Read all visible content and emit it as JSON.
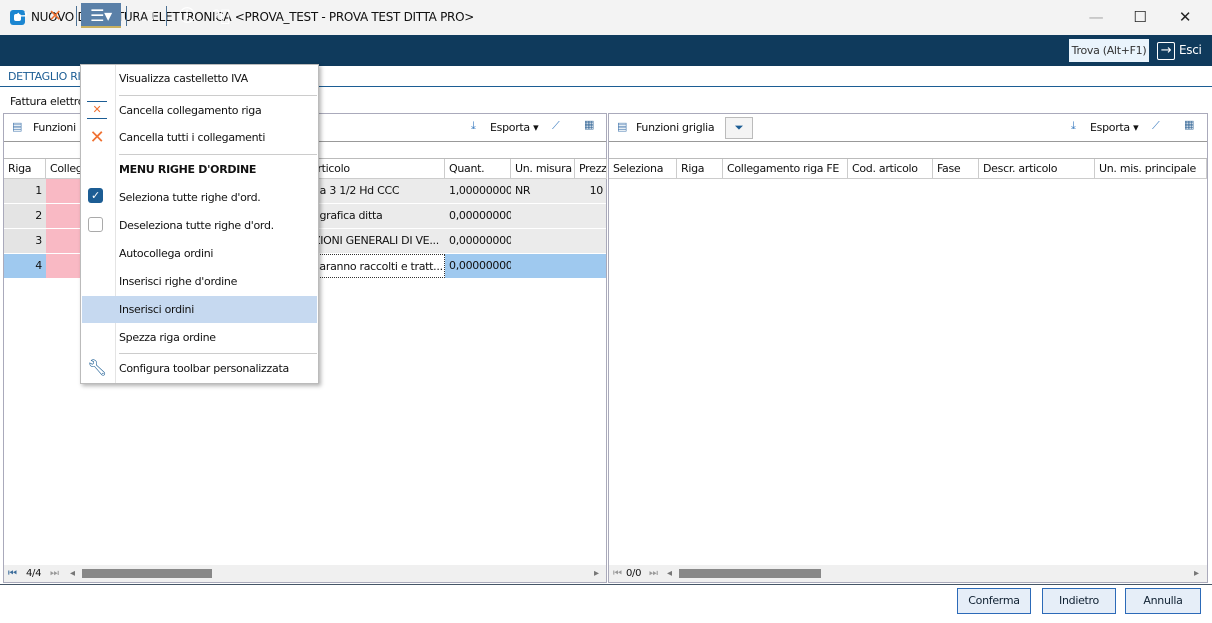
{
  "window": {
    "title": "NUOVO DA FATTURA ELETTRONICA <PROVA_TEST - PROVA TEST DITTA PRO>",
    "minimize": "—",
    "maximize": "☐",
    "close": "✕"
  },
  "toolbar": {
    "find": "Trova (Alt+F1)",
    "exit": "Esci"
  },
  "tab": {
    "label": "DETTAGLIO RI"
  },
  "section": {
    "label": "Fattura elettro"
  },
  "left": {
    "functions": "Funzioni",
    "export": "Esporta",
    "columns": [
      "Riga",
      "Colleg",
      "",
      "articolo",
      "Quant.",
      "Un. misura",
      "Prezz"
    ],
    "rows": [
      {
        "riga": "1",
        "articolo": "da 3 1/2 Hd CCC",
        "quant": "1,00000000",
        "um": "NR",
        "prezzo": "10"
      },
      {
        "riga": "2",
        "articolo": "agrafica ditta",
        "quant": "0,00000000",
        "um": "",
        "prezzo": ""
      },
      {
        "riga": "3",
        "articolo": "ZIONI GENERALI DI VE...",
        "quant": "0,00000000",
        "um": "",
        "prezzo": ""
      },
      {
        "riga": "4",
        "articolo": "saranno raccolti e tratt...",
        "quant": "0,00000000",
        "um": "",
        "prezzo": ""
      }
    ],
    "pager": "4/4"
  },
  "right": {
    "functions": "Funzioni griglia",
    "export": "Esporta",
    "columns": [
      "Seleziona",
      "Riga",
      "Collegamento riga FE",
      "Cod. articolo",
      "Fase",
      "Descr. articolo",
      "Un. mis. principale"
    ],
    "pager": "0/0"
  },
  "menu": {
    "items": [
      "Visualizza castelletto IVA",
      "Cancella collegamento riga",
      "Cancella tutti i collegamenti",
      "MENU RIGHE D'ORDINE",
      "Seleziona tutte righe d'ord.",
      "Deseleziona tutte righe d'ord.",
      "Autocollega ordini",
      "Inserisci righe d'ordine",
      "Inserisci ordini",
      "Spezza riga ordine",
      "Configura toolbar personalizzata"
    ]
  },
  "buttons": {
    "confirm": "Conferma",
    "back": "Indietro",
    "cancel": "Annulla"
  }
}
